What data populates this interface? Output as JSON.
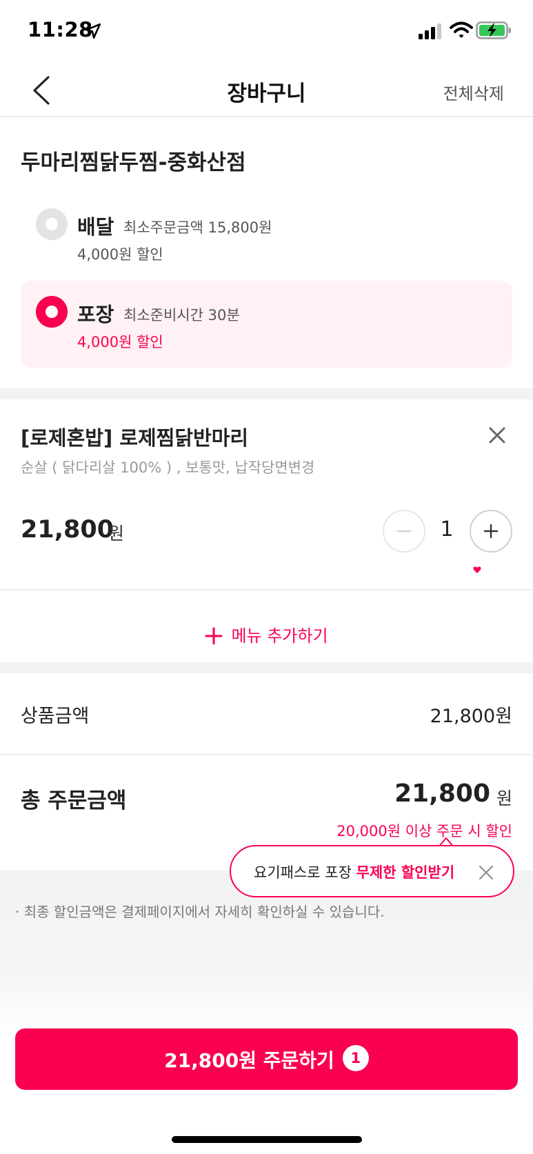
{
  "status_bar": {
    "time": "11:28",
    "icons": [
      "location-arrow-icon",
      "cellular-signal-icon",
      "wifi-icon",
      "battery-charging-icon"
    ]
  },
  "nav": {
    "title": "장바구니",
    "delete_all": "전체삭제",
    "back_icon": "chevron-left-icon"
  },
  "store": {
    "name": "두마리찜닭두찜-중화산점"
  },
  "order_types": [
    {
      "label": "배달",
      "sub": "최소주문금액 15,800원",
      "discount": "4,000원 할인",
      "selected": false
    },
    {
      "label": "포장",
      "sub": "최소준비시간 30분",
      "discount": "4,000원 할인",
      "selected": true
    }
  ],
  "cart_item": {
    "name": "[로제혼밥] 로제찜닭반마리",
    "options": "순살 ( 닭다리살 100% ) , 보통맛, 납작당면변경",
    "price": "21,800",
    "price_unit": "원",
    "quantity": "1"
  },
  "add_menu": {
    "label": "메뉴 추가하기"
  },
  "summary": {
    "subtotal_label": "상품금액",
    "subtotal_value": "21,800원",
    "total_label": "총 주문금액",
    "total_amount": "21,800",
    "total_unit": "원",
    "discount_note": "20,000원 이상 주문 시 할인"
  },
  "tooltip": {
    "prefix": "요기패스로 포장 ",
    "emphasis": "무제한 할인받기"
  },
  "footnote": "· 최종 할인금액은 결제페이지에서 자세히 확인하실 수 있습니다.",
  "order_button": {
    "label": "21,800원 주문하기",
    "badge": "1"
  },
  "colors": {
    "accent": "#fa0050",
    "pickup_bg": "#fff1f4",
    "divider": "#f2f2f2",
    "text_primary": "#222222",
    "text_muted": "#999999"
  }
}
